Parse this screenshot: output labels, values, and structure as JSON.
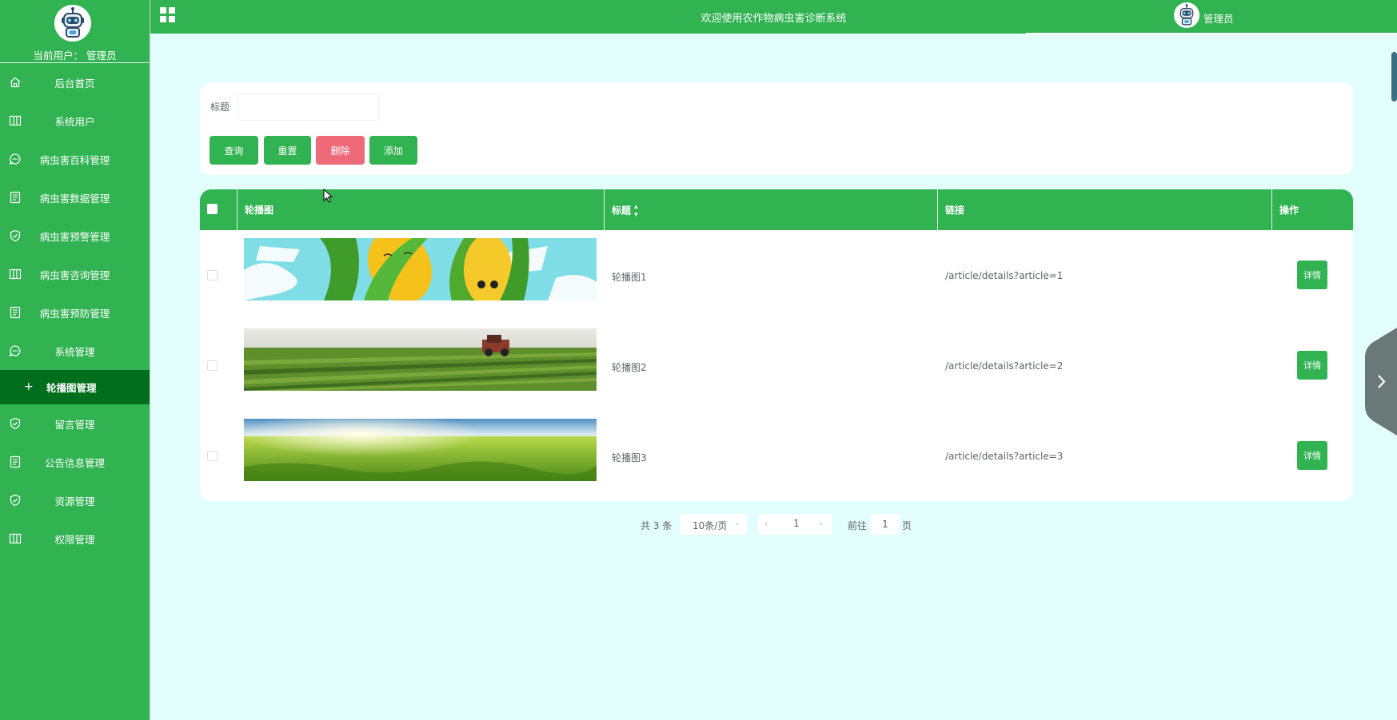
{
  "sidebar": {
    "current_user": "当前用户： 管理员",
    "items": [
      {
        "label": "后台首页",
        "icon": "home-icon"
      },
      {
        "label": "系统用户",
        "icon": "columns-icon"
      },
      {
        "label": "病虫害百科管理",
        "icon": "chat-icon"
      },
      {
        "label": "病虫害数据管理",
        "icon": "document-icon"
      },
      {
        "label": "病虫害预警管理",
        "icon": "shield-check-icon"
      },
      {
        "label": "病虫害咨询管理",
        "icon": "columns-icon"
      },
      {
        "label": "病虫害预防管理",
        "icon": "document-icon"
      },
      {
        "label": "系统管理",
        "icon": "chat-icon"
      },
      {
        "label": "轮播图管理",
        "icon": "plus-icon"
      },
      {
        "label": "留言管理",
        "icon": "shield-check-icon"
      },
      {
        "label": "公告信息管理",
        "icon": "document-icon"
      },
      {
        "label": "资源管理",
        "icon": "shield-check-icon"
      },
      {
        "label": "权限管理",
        "icon": "columns-icon"
      }
    ]
  },
  "topbar": {
    "title": "欢迎使用农作物病虫害诊断系统",
    "user": "管理员"
  },
  "search": {
    "label": "标题",
    "placeholder": "",
    "value": "",
    "buttons": {
      "query": "查询",
      "reset": "重置",
      "delete": "删除",
      "add": "添加"
    }
  },
  "table": {
    "headers": {
      "image": "轮播图",
      "title": "标题",
      "link": "链接",
      "operation": "操作"
    },
    "rows": [
      {
        "title": "轮播图1",
        "link": "/article/details?article=1",
        "action": "详情"
      },
      {
        "title": "轮播图2",
        "link": "/article/details?article=2",
        "action": "详情"
      },
      {
        "title": "轮播图3",
        "link": "/article/details?article=3",
        "action": "详情"
      }
    ]
  },
  "pagination": {
    "total": "共 3 条",
    "page_size": "10条/页",
    "current_page": "1",
    "goto_label": "前往",
    "goto_value": "1",
    "page_unit": "页"
  },
  "colors": {
    "primary": "#31b352",
    "active_menu": "#006e1d",
    "danger": "#ef6a79",
    "background": "#e2fefd"
  }
}
